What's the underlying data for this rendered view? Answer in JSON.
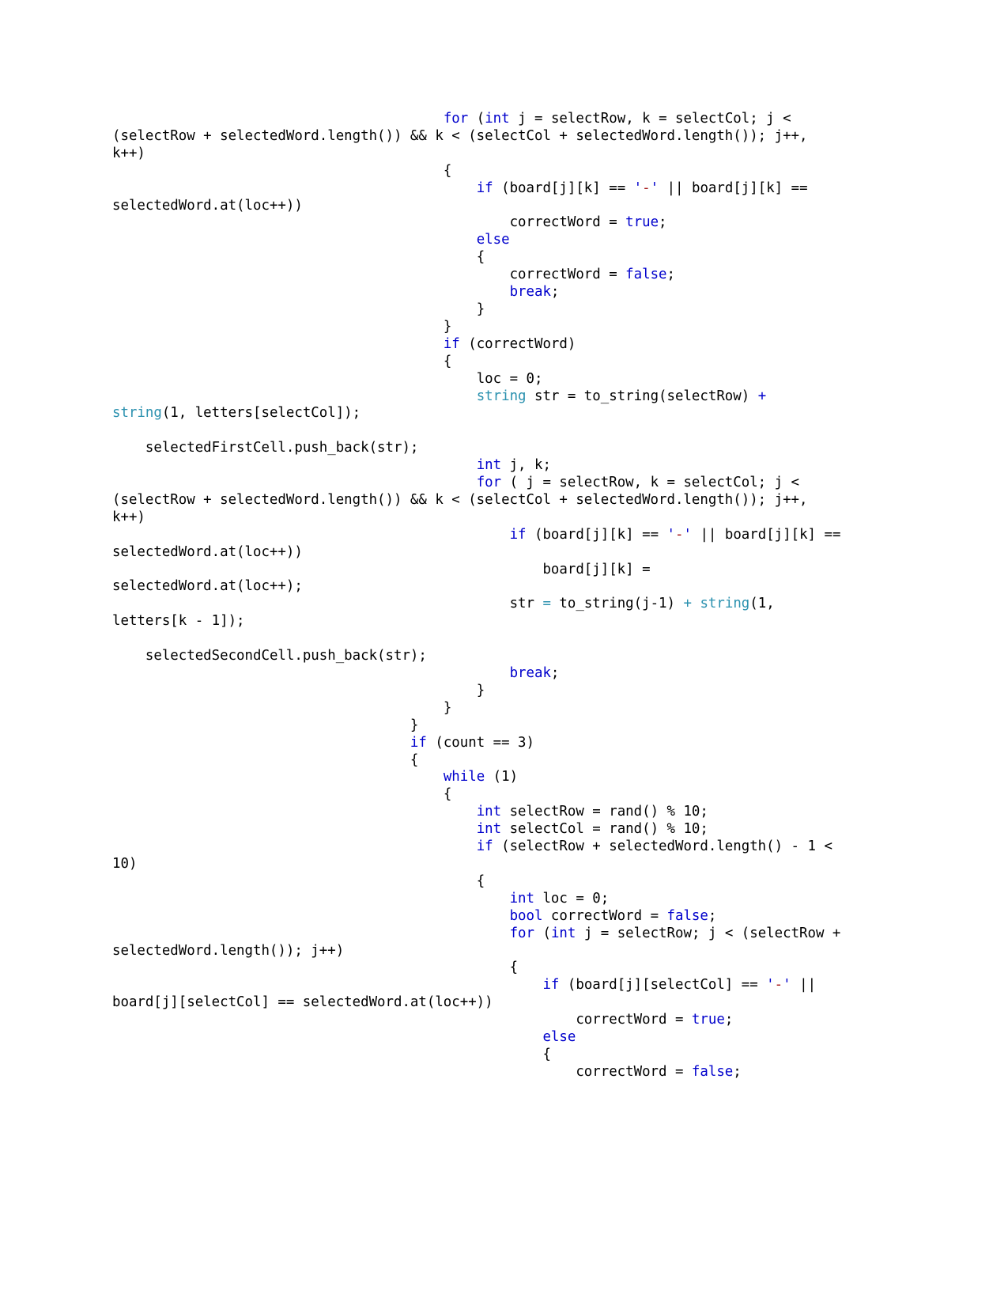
{
  "document": {
    "type": "code-listing",
    "language": "C++",
    "page_background": "#ffffff",
    "text_color": "#000000",
    "colors": {
      "keyword": "#0000CC",
      "type": "#2B91AF",
      "char_literal": "#A31515",
      "operator_teal": "#2B91AF",
      "plain": "#000000"
    }
  },
  "code": {
    "lines": [
      {
        "id": "line-01",
        "text": "                                        for (int j = selectRow, k = selectCol; j < (selectRow + selectedWord.length()) && k < (selectCol + selectedWord.length()); j++, k++)",
        "tokens": [
          {
            "t": "                                        ",
            "c": "pl"
          },
          {
            "t": "for",
            "c": "kw"
          },
          {
            "t": " (",
            "c": "pl"
          },
          {
            "t": "int",
            "c": "kw"
          },
          {
            "t": " j = selectRow, k = selectCol; j < (selectRow + selectedWord.length()) && k < (selectCol + selectedWord.length()); j++, k++)",
            "c": "pl"
          }
        ]
      },
      {
        "id": "line-02",
        "text": "                                        {",
        "tokens": [
          {
            "t": "                                        {",
            "c": "pl"
          }
        ]
      },
      {
        "id": "line-03",
        "text": "                                            if (board[j][k] == '-' || board[j][k] == selectedWord.at(loc++))",
        "tokens": [
          {
            "t": "                                            ",
            "c": "pl"
          },
          {
            "t": "if",
            "c": "kw"
          },
          {
            "t": " (board[j][k] == ",
            "c": "pl"
          },
          {
            "t": "'",
            "c": "chq"
          },
          {
            "t": "-",
            "c": "chr"
          },
          {
            "t": "'",
            "c": "chq"
          },
          {
            "t": " || board[j][k] == selectedWord.at(loc++))",
            "c": "pl"
          }
        ]
      },
      {
        "id": "line-04",
        "text": "                                                correctWord = true;",
        "tokens": [
          {
            "t": "                                                correctWord = ",
            "c": "pl"
          },
          {
            "t": "true",
            "c": "kw"
          },
          {
            "t": ";",
            "c": "pl"
          }
        ]
      },
      {
        "id": "line-05",
        "text": "                                            else",
        "tokens": [
          {
            "t": "                                            ",
            "c": "pl"
          },
          {
            "t": "else",
            "c": "kw"
          }
        ]
      },
      {
        "id": "line-06",
        "text": "                                            {",
        "tokens": [
          {
            "t": "                                            {",
            "c": "pl"
          }
        ]
      },
      {
        "id": "line-07",
        "text": "                                                correctWord = false;",
        "tokens": [
          {
            "t": "                                                correctWord = ",
            "c": "pl"
          },
          {
            "t": "false",
            "c": "kw"
          },
          {
            "t": ";",
            "c": "pl"
          }
        ]
      },
      {
        "id": "line-08",
        "text": "                                                break;",
        "tokens": [
          {
            "t": "                                                ",
            "c": "pl"
          },
          {
            "t": "break",
            "c": "kw"
          },
          {
            "t": ";",
            "c": "pl"
          }
        ]
      },
      {
        "id": "line-09",
        "text": "                                            }",
        "tokens": [
          {
            "t": "                                            }",
            "c": "pl"
          }
        ]
      },
      {
        "id": "line-10",
        "text": "                                        }",
        "tokens": [
          {
            "t": "                                        }",
            "c": "pl"
          }
        ]
      },
      {
        "id": "line-11",
        "text": "                                        if (correctWord)",
        "tokens": [
          {
            "t": "                                        ",
            "c": "pl"
          },
          {
            "t": "if",
            "c": "kw"
          },
          {
            "t": " (correctWord)",
            "c": "pl"
          }
        ]
      },
      {
        "id": "line-12",
        "text": "                                        {",
        "tokens": [
          {
            "t": "                                        {",
            "c": "pl"
          }
        ]
      },
      {
        "id": "line-13",
        "text": "                                            loc = 0;",
        "tokens": [
          {
            "t": "                                            loc = 0;",
            "c": "pl"
          }
        ]
      },
      {
        "id": "line-14",
        "text": "                                            string str = to_string(selectRow) + string(1, letters[selectCol]);",
        "tokens": [
          {
            "t": "                                            ",
            "c": "pl"
          },
          {
            "t": "string",
            "c": "typ"
          },
          {
            "t": " str = to_string(selectRow) ",
            "c": "pl"
          },
          {
            "t": "+",
            "c": "opb"
          },
          {
            "t": " ",
            "c": "pl"
          },
          {
            "t": "string",
            "c": "typ"
          },
          {
            "t": "(1, letters[selectCol]);",
            "c": "pl"
          }
        ]
      },
      {
        "id": "line-15",
        "text": "",
        "tokens": [
          {
            "t": "",
            "c": "pl"
          }
        ]
      },
      {
        "id": "line-16",
        "text": "    selectedFirstCell.push_back(str);",
        "tokens": [
          {
            "t": "    selectedFirstCell.push_back(str);",
            "c": "pl"
          }
        ]
      },
      {
        "id": "line-17",
        "text": "                                            int j, k;",
        "tokens": [
          {
            "t": "                                            ",
            "c": "pl"
          },
          {
            "t": "int",
            "c": "kw"
          },
          {
            "t": " j, k;",
            "c": "pl"
          }
        ]
      },
      {
        "id": "line-18",
        "text": "                                            for ( j = selectRow, k = selectCol; j < (selectRow + selectedWord.length()) && k < (selectCol + selectedWord.length()); j++, k++)",
        "tokens": [
          {
            "t": "                                            ",
            "c": "pl"
          },
          {
            "t": "for",
            "c": "kw"
          },
          {
            "t": " ( j = selectRow, k = selectCol; j < (selectRow + selectedWord.length()) && k < (selectCol + selectedWord.length()); j++, k++)",
            "c": "pl"
          }
        ]
      },
      {
        "id": "line-19",
        "text": "                                                if (board[j][k] == '-' || board[j][k] == selectedWord.at(loc++))",
        "tokens": [
          {
            "t": "                                                ",
            "c": "pl"
          },
          {
            "t": "if",
            "c": "kw"
          },
          {
            "t": " (board[j][k] == ",
            "c": "pl"
          },
          {
            "t": "'",
            "c": "chq"
          },
          {
            "t": "-",
            "c": "chr"
          },
          {
            "t": "'",
            "c": "chq"
          },
          {
            "t": " || board[j][k] == selectedWord.at(loc++))",
            "c": "pl"
          }
        ]
      },
      {
        "id": "line-20",
        "text": "                                                    board[j][k] = selectedWord.at(loc++);",
        "tokens": [
          {
            "t": "                                                    board[j][k] = selectedWord.at(loc++);",
            "c": "pl"
          }
        ]
      },
      {
        "id": "line-21",
        "text": "                                                str = to_string(j-1) + string(1, letters[k - 1]);",
        "tokens": [
          {
            "t": "                                                str ",
            "c": "pl"
          },
          {
            "t": "=",
            "c": "op"
          },
          {
            "t": " to_string(j-1) ",
            "c": "pl"
          },
          {
            "t": "+",
            "c": "op"
          },
          {
            "t": " ",
            "c": "pl"
          },
          {
            "t": "string",
            "c": "typ"
          },
          {
            "t": "(1, letters[k - 1]);",
            "c": "pl"
          }
        ]
      },
      {
        "id": "line-22",
        "text": "",
        "tokens": [
          {
            "t": "",
            "c": "pl"
          }
        ]
      },
      {
        "id": "line-23",
        "text": "    selectedSecondCell.push_back(str);",
        "tokens": [
          {
            "t": "    selectedSecondCell.push_back(str);",
            "c": "pl"
          }
        ]
      },
      {
        "id": "line-24",
        "text": "                                                break;",
        "tokens": [
          {
            "t": "                                                ",
            "c": "pl"
          },
          {
            "t": "break",
            "c": "kw"
          },
          {
            "t": ";",
            "c": "pl"
          }
        ]
      },
      {
        "id": "line-25",
        "text": "                                            }",
        "tokens": [
          {
            "t": "                                            }",
            "c": "pl"
          }
        ]
      },
      {
        "id": "line-26",
        "text": "                                        }",
        "tokens": [
          {
            "t": "                                        }",
            "c": "pl"
          }
        ]
      },
      {
        "id": "line-27",
        "text": "                                    }",
        "tokens": [
          {
            "t": "                                    }",
            "c": "pl"
          }
        ]
      },
      {
        "id": "line-28",
        "text": "                                    if (count == 3)",
        "tokens": [
          {
            "t": "                                    ",
            "c": "pl"
          },
          {
            "t": "if",
            "c": "kw"
          },
          {
            "t": " (count == 3)",
            "c": "pl"
          }
        ]
      },
      {
        "id": "line-29",
        "text": "                                    {",
        "tokens": [
          {
            "t": "                                    {",
            "c": "pl"
          }
        ]
      },
      {
        "id": "line-30",
        "text": "                                        while (1)",
        "tokens": [
          {
            "t": "                                        ",
            "c": "pl"
          },
          {
            "t": "while",
            "c": "kw"
          },
          {
            "t": " (1)",
            "c": "pl"
          }
        ]
      },
      {
        "id": "line-31",
        "text": "                                        {",
        "tokens": [
          {
            "t": "                                        {",
            "c": "pl"
          }
        ]
      },
      {
        "id": "line-32",
        "text": "                                            int selectRow = rand() % 10;",
        "tokens": [
          {
            "t": "                                            ",
            "c": "pl"
          },
          {
            "t": "int",
            "c": "kw"
          },
          {
            "t": " selectRow = rand() % 10;",
            "c": "pl"
          }
        ]
      },
      {
        "id": "line-33",
        "text": "                                            int selectCol = rand() % 10;",
        "tokens": [
          {
            "t": "                                            ",
            "c": "pl"
          },
          {
            "t": "int",
            "c": "kw"
          },
          {
            "t": " selectCol = rand() % 10;",
            "c": "pl"
          }
        ]
      },
      {
        "id": "line-34",
        "text": "                                            if (selectRow + selectedWord.length() - 1 < 10)",
        "tokens": [
          {
            "t": "                                            ",
            "c": "pl"
          },
          {
            "t": "if",
            "c": "kw"
          },
          {
            "t": " (selectRow + selectedWord.length() - 1 < 10)",
            "c": "pl"
          }
        ]
      },
      {
        "id": "line-35",
        "text": "                                            {",
        "tokens": [
          {
            "t": "                                            {",
            "c": "pl"
          }
        ]
      },
      {
        "id": "line-36",
        "text": "                                                int loc = 0;",
        "tokens": [
          {
            "t": "                                                ",
            "c": "pl"
          },
          {
            "t": "int",
            "c": "kw"
          },
          {
            "t": " loc = 0;",
            "c": "pl"
          }
        ]
      },
      {
        "id": "line-37",
        "text": "                                                bool correctWord = false;",
        "tokens": [
          {
            "t": "                                                ",
            "c": "pl"
          },
          {
            "t": "bool",
            "c": "kw"
          },
          {
            "t": " correctWord = ",
            "c": "pl"
          },
          {
            "t": "false",
            "c": "kw"
          },
          {
            "t": ";",
            "c": "pl"
          }
        ]
      },
      {
        "id": "line-38",
        "text": "                                                for (int j = selectRow; j < (selectRow + selectedWord.length()); j++)",
        "tokens": [
          {
            "t": "                                                ",
            "c": "pl"
          },
          {
            "t": "for",
            "c": "kw"
          },
          {
            "t": " (",
            "c": "pl"
          },
          {
            "t": "int",
            "c": "kw"
          },
          {
            "t": " j = selectRow; j < (selectRow + selectedWord.length()); j++)",
            "c": "pl"
          }
        ]
      },
      {
        "id": "line-39",
        "text": "                                                {",
        "tokens": [
          {
            "t": "                                                {",
            "c": "pl"
          }
        ]
      },
      {
        "id": "line-40",
        "text": "                                                    if (board[j][selectCol] == '-' || board[j][selectCol] == selectedWord.at(loc++))",
        "tokens": [
          {
            "t": "                                                    ",
            "c": "pl"
          },
          {
            "t": "if",
            "c": "kw"
          },
          {
            "t": " (board[j][selectCol] == ",
            "c": "pl"
          },
          {
            "t": "'",
            "c": "chq"
          },
          {
            "t": "-",
            "c": "chr"
          },
          {
            "t": "'",
            "c": "chq"
          },
          {
            "t": " || board[j][selectCol] == selectedWord.at(loc++))",
            "c": "pl"
          }
        ]
      },
      {
        "id": "line-41",
        "text": "                                                        correctWord = true;",
        "tokens": [
          {
            "t": "                                                        correctWord = ",
            "c": "pl"
          },
          {
            "t": "true",
            "c": "kw"
          },
          {
            "t": ";",
            "c": "pl"
          }
        ]
      },
      {
        "id": "line-42",
        "text": "                                                    else",
        "tokens": [
          {
            "t": "                                                    ",
            "c": "pl"
          },
          {
            "t": "else",
            "c": "kw"
          }
        ]
      },
      {
        "id": "line-43",
        "text": "                                                    {",
        "tokens": [
          {
            "t": "                                                    {",
            "c": "pl"
          }
        ]
      },
      {
        "id": "line-44",
        "text": "                                                        correctWord = false;",
        "tokens": [
          {
            "t": "                                                        correctWord = ",
            "c": "pl"
          },
          {
            "t": "false",
            "c": "kw"
          },
          {
            "t": ";",
            "c": "pl"
          }
        ]
      }
    ]
  }
}
